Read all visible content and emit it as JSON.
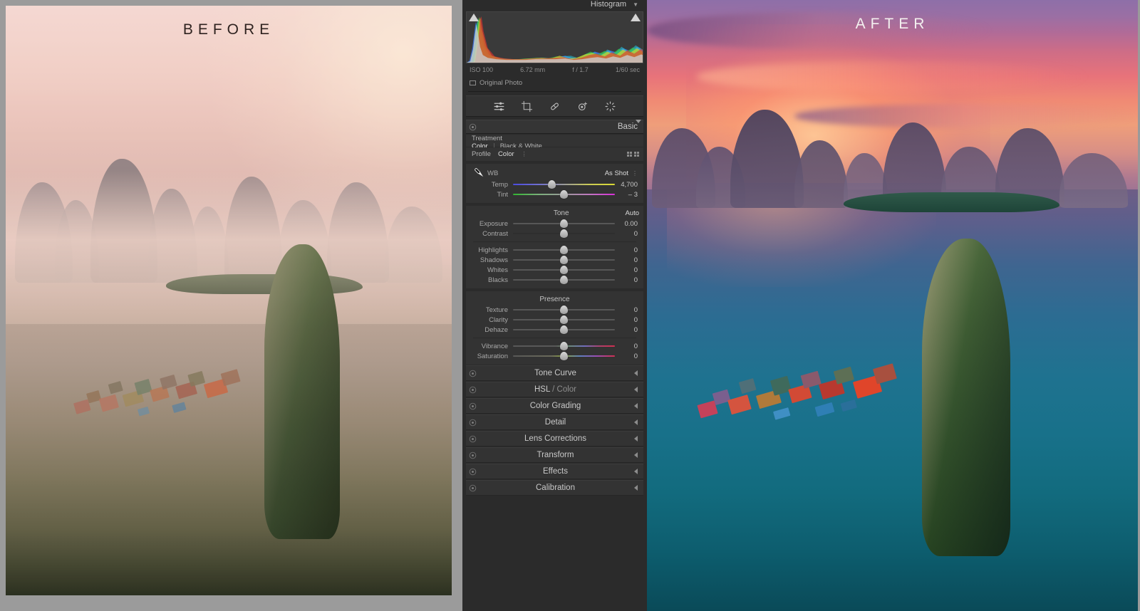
{
  "comparison": {
    "before_label": "BEFORE",
    "after_label": "AFTER"
  },
  "panel": {
    "histogram": {
      "title": "Histogram",
      "collapse_icon": "chevron-down-icon",
      "iso": "ISO 100",
      "focal_length": "6.72 mm",
      "aperture": "f / 1.7",
      "shutter": "1/60 sec",
      "original_photo_label": "Original Photo"
    },
    "tools": [
      {
        "name": "edit-sliders-icon",
        "title": "Edit"
      },
      {
        "name": "crop-icon",
        "title": "Crop & Straighten"
      },
      {
        "name": "healing-brush-icon",
        "title": "Healing Brush"
      },
      {
        "name": "red-eye-icon",
        "title": "Red Eye Correction"
      },
      {
        "name": "masking-icon",
        "title": "Masking"
      }
    ],
    "basic": {
      "title": "Basic",
      "eye_icon": "panel-switch-icon",
      "expand_icon": "chevron-down-icon",
      "treatment": {
        "label": "Treatment",
        "options": [
          "Color",
          "Black & White"
        ],
        "selected": "Color"
      },
      "profile": {
        "label": "Profile",
        "value": "Color",
        "browse_icon": "profile-grid-icon"
      },
      "white_balance": {
        "eyedropper_icon": "eyedropper-icon",
        "label": "WB",
        "value": "As Shot",
        "sliders": [
          {
            "name": "Temp",
            "value": "4,700",
            "pos": 38
          },
          {
            "name": "Tint",
            "value": "– 3",
            "pos": 50
          }
        ]
      },
      "tone": {
        "title": "Tone",
        "auto_label": "Auto",
        "sliders": [
          {
            "name": "Exposure",
            "value": "0.00",
            "pos": 50
          },
          {
            "name": "Contrast",
            "value": "0",
            "pos": 50
          },
          {
            "name": "Highlights",
            "value": "0",
            "pos": 50
          },
          {
            "name": "Shadows",
            "value": "0",
            "pos": 50
          },
          {
            "name": "Whites",
            "value": "0",
            "pos": 50
          },
          {
            "name": "Blacks",
            "value": "0",
            "pos": 50
          }
        ]
      },
      "presence": {
        "title": "Presence",
        "sliders": [
          {
            "name": "Texture",
            "value": "0",
            "pos": 50
          },
          {
            "name": "Clarity",
            "value": "0",
            "pos": 50
          },
          {
            "name": "Dehaze",
            "value": "0",
            "pos": 50
          }
        ],
        "color_sliders": [
          {
            "name": "Vibrance",
            "value": "0",
            "pos": 50
          },
          {
            "name": "Saturation",
            "value": "0",
            "pos": 50
          }
        ]
      }
    },
    "collapsed_panels": [
      {
        "name": "Tone Curve"
      },
      {
        "name": "HSL",
        "sub": " / Color"
      },
      {
        "name": "Color Grading"
      },
      {
        "name": "Detail"
      },
      {
        "name": "Lens Corrections"
      },
      {
        "name": "Transform"
      },
      {
        "name": "Effects"
      },
      {
        "name": "Calibration"
      }
    ]
  },
  "colors": {
    "panel_bg": "#2b2b2b",
    "panel_section": "#333333",
    "text": "#b4b4b4",
    "text_bright": "#dcdcdc",
    "gutter": "#9a9a9a"
  }
}
